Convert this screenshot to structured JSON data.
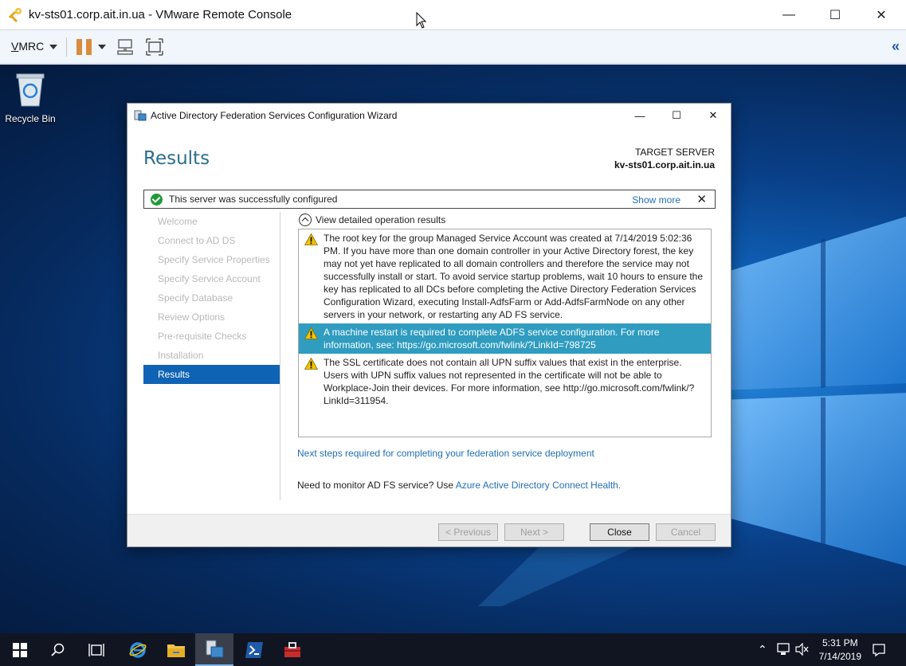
{
  "vmrc": {
    "window_title": "kv-sts01.corp.ait.in.ua - VMware Remote Console",
    "menu_label_prefix": "V",
    "menu_label_rest": "MRC",
    "window_controls": {
      "minimize": "—",
      "maximize": "☐",
      "close": "✕"
    },
    "collapse_glyph": "«"
  },
  "desktop": {
    "recycle_bin_label": "Recycle Bin"
  },
  "wizard": {
    "title": "Active Directory Federation Services Configuration Wizard",
    "heading": "Results",
    "target_server_label": "TARGET SERVER",
    "target_server_value": "kv-sts01.corp.ait.in.ua",
    "status_message": "This server was successfully configured",
    "show_more": "Show more",
    "status_close": "✕",
    "nav": [
      {
        "label": "Welcome"
      },
      {
        "label": "Connect to AD DS"
      },
      {
        "label": "Specify Service Properties"
      },
      {
        "label": "Specify Service Account"
      },
      {
        "label": "Specify Database"
      },
      {
        "label": "Review Options"
      },
      {
        "label": "Pre-requisite Checks"
      },
      {
        "label": "Installation"
      },
      {
        "label": "Results"
      }
    ],
    "detail_toggle": "View detailed operation results",
    "results": [
      {
        "text": "The root key for the group Managed Service Account was created at 7/14/2019 5:02:36 PM. If you have more than one domain controller in your Active Directory forest, the key may not yet have replicated to all domain controllers and therefore the service may not successfully install or start.  To avoid service startup problems, wait 10 hours to ensure the key has replicated to all DCs before completing the Active Directory Federation Services Configuration Wizard, executing Install-AdfsFarm or Add-AdfsFarmNode on any other servers in your network, or restarting any AD FS service."
      },
      {
        "text": "A machine restart is required to complete ADFS service configuration. For more information, see: https://go.microsoft.com/fwlink/?LinkId=798725"
      },
      {
        "text": "The SSL certificate does not contain all UPN suffix values that exist in the enterprise.  Users with UPN suffix values not represented in the certificate will not be able to Workplace-Join their devices.  For more information, see http://go.microsoft.com/fwlink/?LinkId=311954."
      }
    ],
    "next_steps_link": "Next steps required for completing your federation service deployment",
    "monitor_text": "Need to monitor AD FS service? Use ",
    "monitor_link": "Azure Active Directory Connect Health.",
    "buttons": {
      "previous": "< Previous",
      "next": "Next >",
      "close": "Close",
      "cancel": "Cancel"
    },
    "window_controls": {
      "minimize": "—",
      "maximize": "☐",
      "close": "✕"
    }
  },
  "taskbar": {
    "time": "5:31 PM",
    "date": "7/14/2019",
    "icons": [
      "windows-start-icon",
      "search-icon",
      "task-view-icon",
      "internet-explorer-icon",
      "file-explorer-icon",
      "server-manager-icon",
      "powershell-icon",
      "toolbox-icon"
    ]
  },
  "colors": {
    "accent": "#0f63b4",
    "heading": "#2b6f8c",
    "selected_row": "#2f9cc0",
    "link": "#1f6fb5",
    "success": "#1f9a36",
    "warning": "#f2c300"
  }
}
